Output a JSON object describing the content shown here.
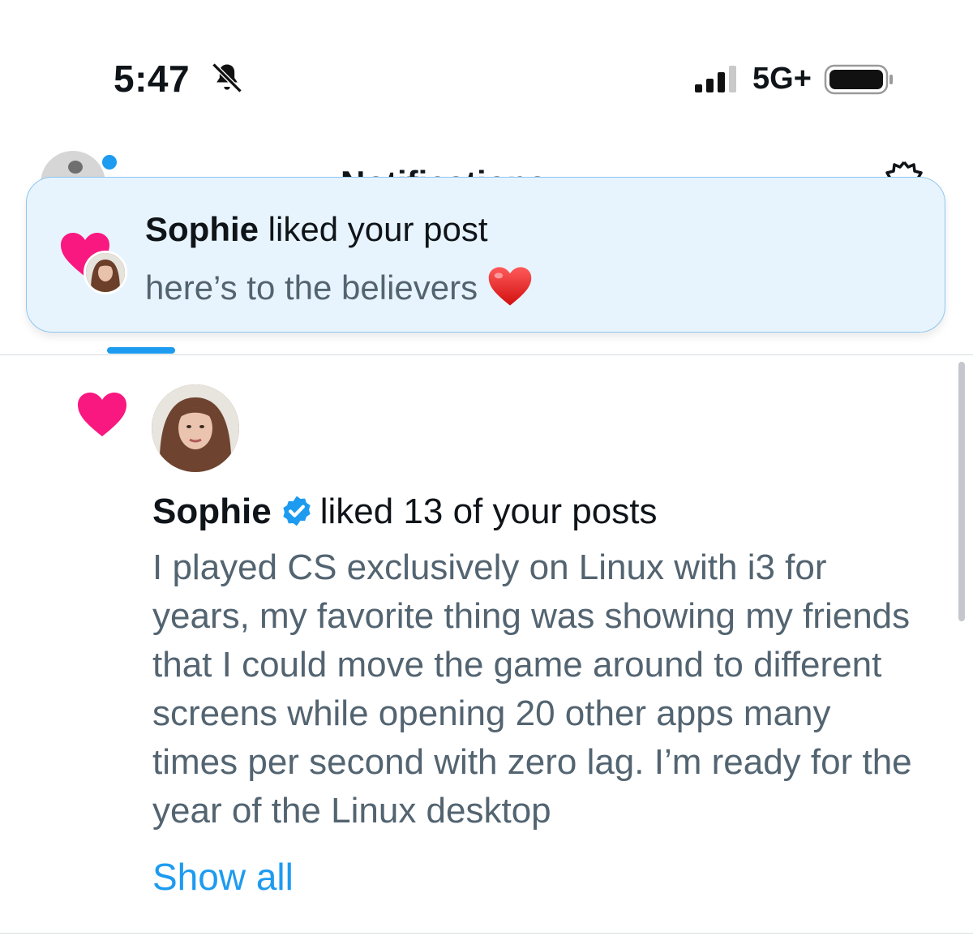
{
  "status_bar": {
    "time": "5:47",
    "network": "5G+",
    "icons": [
      "bell-muted-icon",
      "signal-icon",
      "battery-icon"
    ]
  },
  "header": {
    "title": "Notifications",
    "icons": [
      "avatar",
      "gear-icon"
    ]
  },
  "toast": {
    "user": "Sophie",
    "action": " liked your post",
    "post_text": "here’s to the believers",
    "emoji": "red-heart-icon"
  },
  "notification": {
    "user": "Sophie",
    "action": "liked 13 of your posts",
    "verified": true,
    "post_text": "I played CS exclusively on Linux with i3 for\nyears, my favorite thing was showing my friends\nthat I could move the game around to different\nscreens while opening 20 other apps many\ntimes per second with zero lag. I’m ready for the\nyear of the Linux desktop",
    "show_all": "Show all"
  },
  "colors": {
    "accent": "#1d9bf0",
    "like": "#f91880",
    "toast_bg": "#e8f4fd",
    "secondary_text": "#536471"
  }
}
